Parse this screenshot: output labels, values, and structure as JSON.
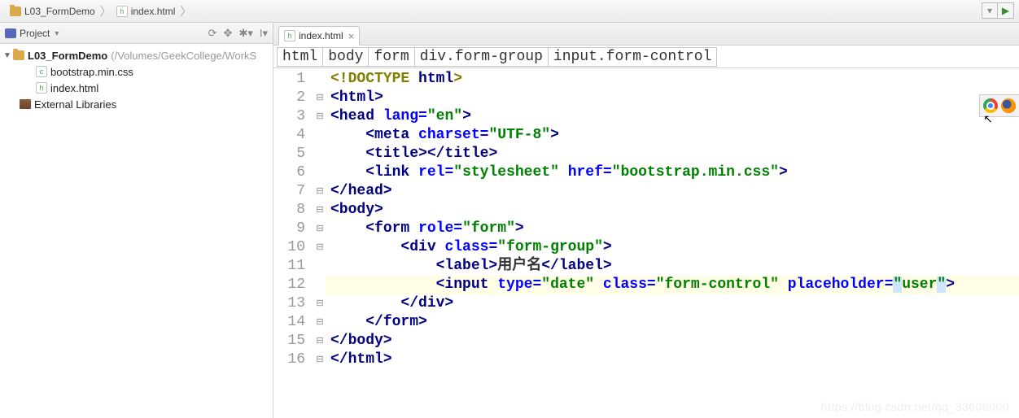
{
  "breadcrumb": {
    "project": "L03_FormDemo",
    "file": "index.html"
  },
  "projectPanel": {
    "title": "Project",
    "root": "L03_FormDemo",
    "rootPath": "(/Volumes/GeekCollege/WorkS",
    "files": [
      "bootstrap.min.css",
      "index.html"
    ],
    "external": "External Libraries"
  },
  "tab": {
    "name": "index.html"
  },
  "pathBar": [
    "html",
    "body",
    "form",
    "div.form-group",
    "input.form-control"
  ],
  "code": {
    "lines": [
      {
        "n": 1,
        "fold": "",
        "html": "<span class='doctype'>&lt;!DOCTYPE</span> <span class='doctype-kw'>html</span><span class='doctype'>&gt;</span>"
      },
      {
        "n": 2,
        "fold": "⊟",
        "html": "<span class='tag'>&lt;html&gt;</span>"
      },
      {
        "n": 3,
        "fold": "⊟",
        "html": "<span class='tag'>&lt;head</span> <span class='attr'>lang=</span><span class='val'>\"en\"</span><span class='tag'>&gt;</span>"
      },
      {
        "n": 4,
        "fold": "",
        "html": "    <span class='tag'>&lt;meta</span> <span class='attr'>charset=</span><span class='val'>\"UTF-8\"</span><span class='tag'>&gt;</span>"
      },
      {
        "n": 5,
        "fold": "",
        "html": "    <span class='tag'>&lt;title&gt;&lt;/title&gt;</span>"
      },
      {
        "n": 6,
        "fold": "",
        "html": "    <span class='tag'>&lt;link</span> <span class='attr'>rel=</span><span class='val'>\"stylesheet\"</span> <span class='attr'>href=</span><span class='val'>\"bootstrap.min.css\"</span><span class='tag'>&gt;</span>"
      },
      {
        "n": 7,
        "fold": "⊟",
        "html": "<span class='tag'>&lt;/head&gt;</span>"
      },
      {
        "n": 8,
        "fold": "⊟",
        "html": "<span class='tag'>&lt;body&gt;</span>"
      },
      {
        "n": 9,
        "fold": "⊟",
        "html": "    <span class='tag'>&lt;form</span> <span class='attr'>role=</span><span class='val'>\"form\"</span><span class='tag'>&gt;</span>"
      },
      {
        "n": 10,
        "fold": "⊟",
        "html": "        <span class='tag'>&lt;div</span> <span class='attr'>class=</span><span class='val'>\"form-group\"</span><span class='tag'>&gt;</span>"
      },
      {
        "n": 11,
        "fold": "",
        "html": "            <span class='tag'>&lt;label&gt;</span><span class='txt'>用户名</span><span class='tag'>&lt;/label&gt;</span>"
      },
      {
        "n": 12,
        "fold": "",
        "html": "            <span class='tag'>&lt;input</span> <span class='attr'>type=</span><span class='val'>\"date\"</span> <span class='attr'>class=</span><span class='val'>\"form-control\"</span> <span class='attr'>placeholder=</span><span class='val'><span class='sel'>\"</span>user<span class='sel'>\"</span></span><span class='tag'>&gt;</span>"
      },
      {
        "n": 13,
        "fold": "⊟",
        "html": "        <span class='tag'>&lt;/div&gt;</span>"
      },
      {
        "n": 14,
        "fold": "⊟",
        "html": "    <span class='tag'>&lt;/form&gt;</span>"
      },
      {
        "n": 15,
        "fold": "⊟",
        "html": "<span class='tag'>&lt;/body&gt;</span>"
      },
      {
        "n": 16,
        "fold": "⊟",
        "html": "<span class='tag'>&lt;/html&gt;</span>"
      }
    ],
    "highlightLine": 12
  },
  "watermark": "https://blog.csdn.net/qq_33608000"
}
